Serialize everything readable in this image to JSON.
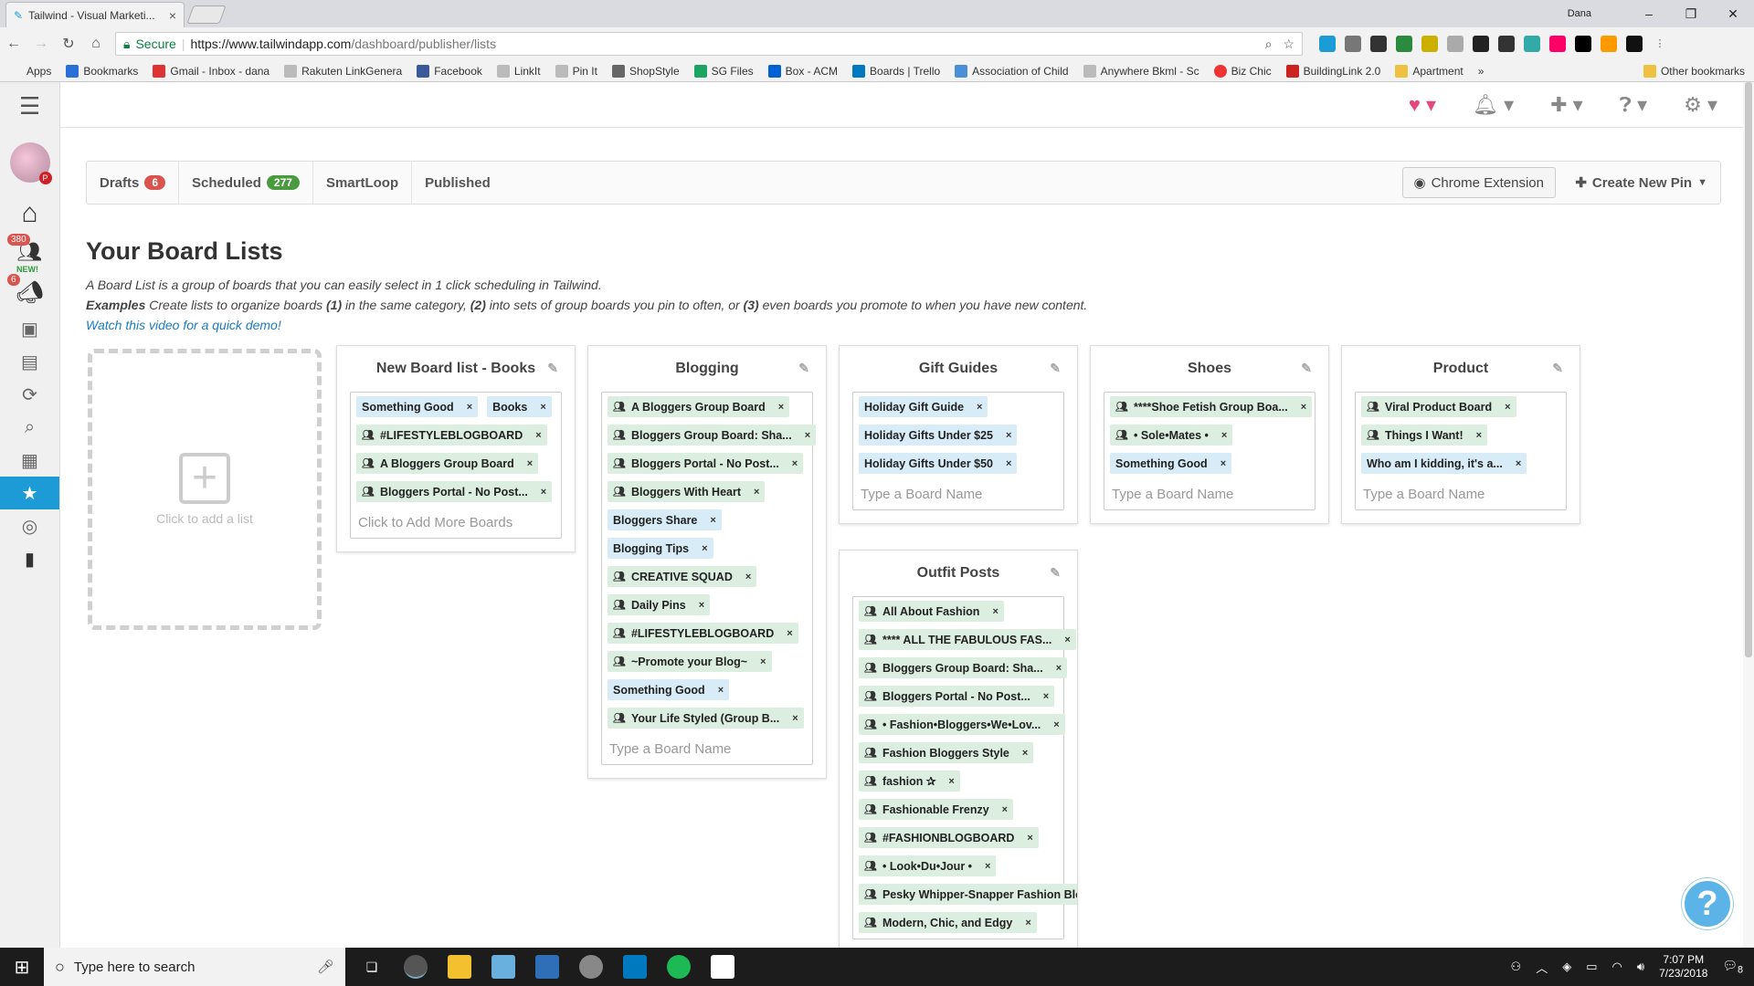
{
  "browser": {
    "tab_title": "Tailwind - Visual Marketi...",
    "tab_close": "×",
    "user": "Dana",
    "secure_label": "Secure",
    "url_host": "https://www.tailwindapp.com",
    "url_path": "/dashboard/publisher/lists",
    "bookmarks": [
      {
        "label": "Apps",
        "color": "#e44"
      },
      {
        "label": "Bookmarks",
        "color": "#2a6fd6"
      },
      {
        "label": "Gmail - Inbox - dana",
        "color": "#d33"
      },
      {
        "label": "Rakuten LinkGenera",
        "color": "#999"
      },
      {
        "label": "Facebook",
        "color": "#3b5998"
      },
      {
        "label": "LinkIt",
        "color": "#999"
      },
      {
        "label": "Pin It",
        "color": "#999"
      },
      {
        "label": "ShopStyle",
        "color": "#666"
      },
      {
        "label": "SG Files",
        "color": "#1da462"
      },
      {
        "label": "Box - ACM",
        "color": "#0061d5"
      },
      {
        "label": "Boards | Trello",
        "color": "#0079bf"
      },
      {
        "label": "Association of Child",
        "color": "#4a90d9"
      },
      {
        "label": "Anywhere Bkml - Sc",
        "color": "#999"
      },
      {
        "label": "Biz Chic",
        "color": "#e33"
      },
      {
        "label": "BuildingLink 2.0",
        "color": "#c22"
      },
      {
        "label": "Apartment",
        "color": "#f0c040"
      }
    ],
    "bookmarks_more": "»",
    "other_bookmarks": "Other bookmarks"
  },
  "sidebar": {
    "badges": {
      "followers": "380",
      "new": "NEW!",
      "campaigns": "6"
    }
  },
  "tabs": [
    {
      "label": "Drafts",
      "count": "6",
      "color": "red"
    },
    {
      "label": "Scheduled",
      "count": "277",
      "color": "green"
    },
    {
      "label": "SmartLoop",
      "count": ""
    },
    {
      "label": "Published",
      "count": ""
    }
  ],
  "actions": {
    "chrome_extension": "Chrome Extension",
    "create_pin": "Create New Pin"
  },
  "page": {
    "title": "Your Board Lists",
    "line1": "A Board List is a group of boards that you can easily select in 1 click scheduling in Tailwind.",
    "ex_label": "Examples",
    "ex_text_a": " Create lists to organize boards ",
    "ex_1": "(1)",
    "ex_text_b": " in the same category, ",
    "ex_2": "(2)",
    "ex_text_c": " into sets of group boards you pin to often, or ",
    "ex_3": "(3)",
    "ex_text_d": " even boards you promote to when you have new content.",
    "video_link": "Watch this video for a quick demo!",
    "add_list": "Click to add a list"
  },
  "lists": [
    {
      "name": "New Board list - Books",
      "input": "Click to Add More Boards",
      "boards": [
        {
          "label": "Something Good",
          "group": false
        },
        {
          "label": "Books",
          "group": false
        },
        {
          "label": "#LIFESTYLEBLOGBOARD",
          "group": true
        },
        {
          "label": "A Bloggers Group Board",
          "group": true
        },
        {
          "label": "Bloggers Portal - No Post...",
          "group": true
        }
      ]
    },
    {
      "name": "Blogging",
      "input": "Type a Board Name",
      "boards": [
        {
          "label": "A Bloggers Group Board",
          "group": true
        },
        {
          "label": "Bloggers Group Board: Sha...",
          "group": true
        },
        {
          "label": "Bloggers Portal - No Post...",
          "group": true
        },
        {
          "label": "Bloggers With Heart",
          "group": true
        },
        {
          "label": "Bloggers Share",
          "group": false
        },
        {
          "label": "Blogging Tips",
          "group": false
        },
        {
          "label": "CREATIVE SQUAD",
          "group": true
        },
        {
          "label": "Daily Pins",
          "group": true
        },
        {
          "label": "#LIFESTYLEBLOGBOARD",
          "group": true
        },
        {
          "label": "~Promote your Blog~",
          "group": true
        },
        {
          "label": "Something Good",
          "group": false
        },
        {
          "label": "Your Life Styled (Group B...",
          "group": true
        }
      ]
    },
    {
      "name": "Gift Guides",
      "input": "Type a Board Name",
      "boards": [
        {
          "label": "Holiday Gift Guide",
          "group": false
        },
        {
          "label": "Holiday Gifts Under $25",
          "group": false
        },
        {
          "label": "Holiday Gifts Under $50",
          "group": false
        }
      ]
    },
    {
      "name": "Shoes",
      "input": "Type a Board Name",
      "boards": [
        {
          "label": "****Shoe Fetish Group Boa...",
          "group": true
        },
        {
          "label": "• Sole•Mates •",
          "group": true
        },
        {
          "label": "Something Good",
          "group": false
        }
      ]
    },
    {
      "name": "Product",
      "input": "Type a Board Name",
      "boards": [
        {
          "label": "Viral Product Board",
          "group": true
        },
        {
          "label": "Things I Want!",
          "group": true
        },
        {
          "label": "Who am I kidding, it's a...",
          "group": false
        }
      ]
    },
    {
      "name": "Outfit Posts",
      "input": "",
      "boards": [
        {
          "label": "All About Fashion",
          "group": true
        },
        {
          "label": "**** ALL THE FABULOUS FAS...",
          "group": true
        },
        {
          "label": "Bloggers Group Board: Sha...",
          "group": true
        },
        {
          "label": "Bloggers Portal - No Post...",
          "group": true
        },
        {
          "label": "• Fashion•Bloggers•We•Lov...",
          "group": true
        },
        {
          "label": "Fashion Bloggers Style",
          "group": true
        },
        {
          "label": "fashion ✰",
          "group": true
        },
        {
          "label": "Fashionable Frenzy",
          "group": true
        },
        {
          "label": "#FASHIONBLOGBOARD",
          "group": true
        },
        {
          "label": "• Look•Du•Jour •",
          "group": true
        },
        {
          "label": "Pesky Whipper-Snapper Fashion Blogge...",
          "group": true
        },
        {
          "label": "Modern, Chic, and Edgy",
          "group": true
        }
      ]
    }
  ],
  "help_button": "?",
  "taskbar": {
    "search_placeholder": "Type here to search",
    "time": "7:07 PM",
    "date": "7/23/2018",
    "notif_count": "8"
  }
}
